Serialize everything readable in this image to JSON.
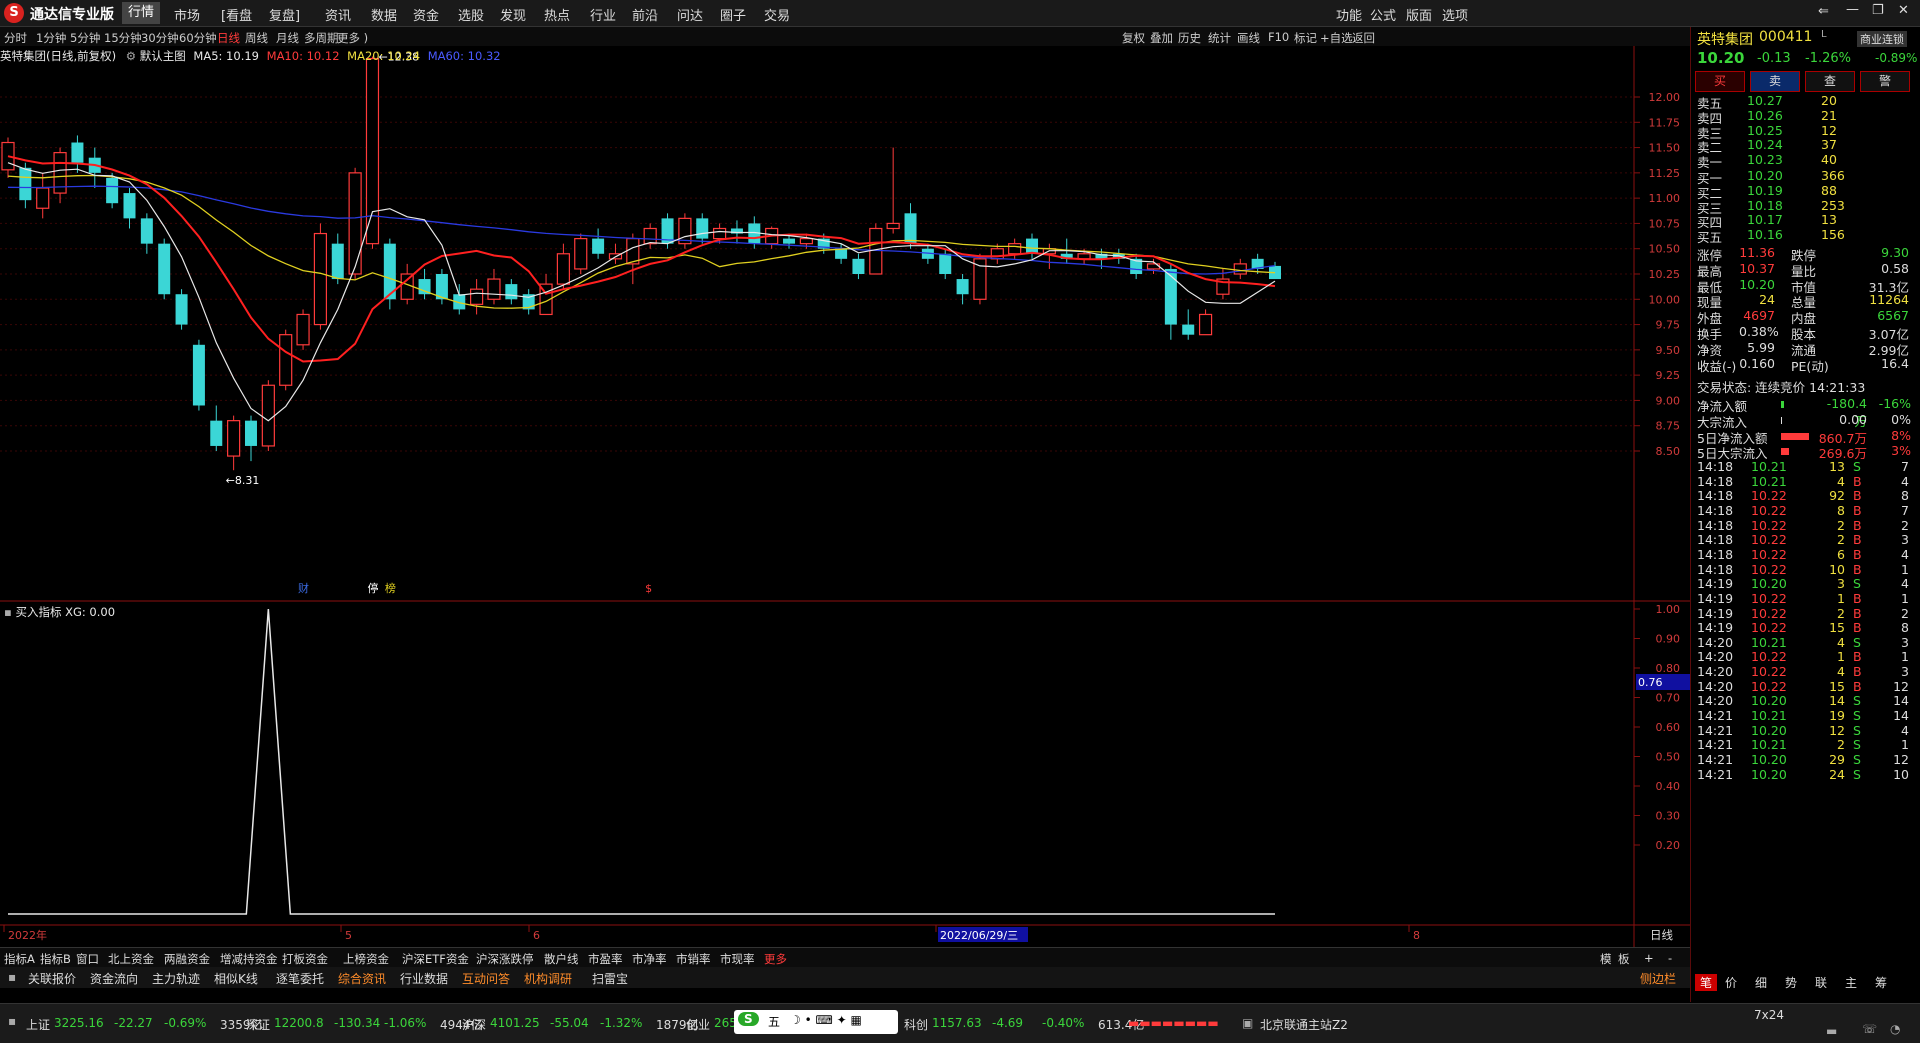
{
  "app": {
    "title": "通达信专业版"
  },
  "menu": [
    "行情",
    "市场",
    "[看盘",
    "复盘]",
    "资讯",
    "数据",
    "资金",
    "选股",
    "发现",
    "热点",
    "行业",
    "前沿",
    "问达",
    "圈子",
    "交易"
  ],
  "menu_right": [
    "功能",
    "公式",
    "版面",
    "选项"
  ],
  "periods": [
    "分时",
    "1分钟",
    "5分钟",
    "15分钟",
    "30分钟",
    "60分钟",
    "日线",
    "周线",
    "月线",
    "多周期",
    "更多 )"
  ],
  "active_period": "日线",
  "tools": [
    "复权",
    "叠加",
    "历史",
    "统计",
    "画线",
    "F10",
    "标记",
    "+自选",
    "返回"
  ],
  "chart_header": {
    "name": "英特集团(日线,前复权)",
    "template": "默认主图",
    "ma5": "MA5: 10.19",
    "ma10": "MA10: 10.12",
    "ma20": "MA20: 10.24",
    "ma60": "MA60: 10.32"
  },
  "main_axis": [
    "12.00",
    "11.75",
    "11.50",
    "11.25",
    "11.00",
    "10.75",
    "10.50",
    "10.25",
    "10.00",
    "9.75",
    "9.50",
    "9.25",
    "9.00",
    "8.75",
    "8.50"
  ],
  "high_mark": "12.38",
  "low_mark": "←8.31",
  "event_marks": [
    "财",
    "停",
    "榜",
    "$"
  ],
  "sub_header": "买入指标 XG: 0.00",
  "sub_axis": [
    "1.00",
    "0.90",
    "0.80",
    "0.70",
    "0.60",
    "0.50",
    "0.40",
    "0.30",
    "0.20"
  ],
  "sub_current": "0.76",
  "time_axis": {
    "year": "2022年",
    "m5": "5",
    "m6": "6",
    "date": "2022/06/29/三",
    "m8": "8"
  },
  "period_label": "日线",
  "indicator_tabs": [
    "指标A",
    "指标B",
    "窗口",
    "北上资金",
    "两融资金",
    "增减持资金",
    "打板资金",
    "上榜资金",
    "沪深ETF资金",
    "沪深涨跌停",
    "散户线",
    "市盈率",
    "市净率",
    "市销率",
    "市现率",
    "更多"
  ],
  "indicator_right": [
    "模",
    "板",
    "+",
    "-"
  ],
  "sub_tabs": [
    "关联报价",
    "资金流向",
    "主力轨迹",
    "相似K线",
    "逐笔委托",
    "综合资讯",
    "行业数据",
    "互动问答",
    "机构调研",
    "扫雷宝"
  ],
  "side_label": "侧边栏",
  "quote": {
    "name": "英特集团",
    "code": "000411",
    "price": "10.20",
    "change": "-0.13",
    "pct": "-1.26%",
    "sector": "商业连锁",
    "sector_pct": "-0.89%",
    "buttons": [
      "买",
      "卖",
      "查",
      "警"
    ]
  },
  "order_book": {
    "asks": [
      [
        "卖五",
        "10.27",
        "20"
      ],
      [
        "卖四",
        "10.26",
        "21"
      ],
      [
        "卖三",
        "10.25",
        "12"
      ],
      [
        "卖二",
        "10.24",
        "37"
      ],
      [
        "卖一",
        "10.23",
        "40"
      ]
    ],
    "bids": [
      [
        "买一",
        "10.20",
        "366"
      ],
      [
        "买二",
        "10.19",
        "88"
      ],
      [
        "买三",
        "10.18",
        "253"
      ],
      [
        "买四",
        "10.17",
        "13"
      ],
      [
        "买五",
        "10.16",
        "156"
      ]
    ]
  },
  "stats": [
    [
      "涨停",
      "11.36",
      "跌停",
      "9.30"
    ],
    [
      "最高",
      "10.37",
      "量比",
      "0.58"
    ],
    [
      "最低",
      "10.20",
      "市值",
      "31.3亿"
    ],
    [
      "现量",
      "24",
      "总量",
      "11264"
    ],
    [
      "外盘",
      "4697",
      "内盘",
      "6567"
    ],
    [
      "换手",
      "0.38%",
      "股本",
      "3.07亿"
    ],
    [
      "净资",
      "5.99",
      "流通",
      "2.99亿"
    ],
    [
      "收益(-)",
      "0.160",
      "PE(动)",
      "16.4"
    ]
  ],
  "trade_status": "交易状态: 连续竞价 14:21:33",
  "flows": [
    [
      "净流入额",
      "-180.4万",
      "-16%"
    ],
    [
      "大宗流入",
      "0.00",
      "0%"
    ],
    [
      "5日净流入额",
      "860.7万",
      "8%"
    ],
    [
      "5日大宗流入",
      "269.6万",
      "3%"
    ]
  ],
  "ticks": [
    [
      "14:18",
      "10.21",
      "13",
      "S",
      "7"
    ],
    [
      "14:18",
      "10.21",
      "4",
      "B",
      "4"
    ],
    [
      "14:18",
      "10.22",
      "92",
      "B",
      "8"
    ],
    [
      "14:18",
      "10.22",
      "8",
      "B",
      "7"
    ],
    [
      "14:18",
      "10.22",
      "2",
      "B",
      "2"
    ],
    [
      "14:18",
      "10.22",
      "2",
      "B",
      "3"
    ],
    [
      "14:18",
      "10.22",
      "6",
      "B",
      "4"
    ],
    [
      "14:18",
      "10.22",
      "10",
      "B",
      "1"
    ],
    [
      "14:19",
      "10.20",
      "3",
      "S",
      "4"
    ],
    [
      "14:19",
      "10.22",
      "1",
      "B",
      "1"
    ],
    [
      "14:19",
      "10.22",
      "2",
      "B",
      "2"
    ],
    [
      "14:19",
      "10.22",
      "15",
      "B",
      "8"
    ],
    [
      "14:20",
      "10.21",
      "4",
      "S",
      "3"
    ],
    [
      "14:20",
      "10.22",
      "1",
      "B",
      "1"
    ],
    [
      "14:20",
      "10.22",
      "4",
      "B",
      "3"
    ],
    [
      "14:20",
      "10.22",
      "15",
      "B",
      "12"
    ],
    [
      "14:20",
      "10.20",
      "14",
      "S",
      "14"
    ],
    [
      "14:21",
      "10.21",
      "19",
      "S",
      "14"
    ],
    [
      "14:21",
      "10.20",
      "12",
      "S",
      "4"
    ],
    [
      "14:21",
      "10.21",
      "2",
      "S",
      "1"
    ],
    [
      "14:21",
      "10.20",
      "29",
      "S",
      "12"
    ],
    [
      "14:21",
      "10.20",
      "24",
      "S",
      "10"
    ]
  ],
  "right_tabs": [
    "笔",
    "价",
    "细",
    "势",
    "联",
    "主",
    "筹"
  ],
  "status": {
    "sh": [
      "上证",
      "3225.16",
      "-22.27",
      "-0.69%",
      "3359亿"
    ],
    "sz": [
      "深证",
      "12200.8",
      "-130.34",
      "-1.06%",
      "4944亿"
    ],
    "hs": [
      "沪深",
      "4101.25",
      "-55.04",
      "-1.32%",
      "1879亿"
    ],
    "cy": [
      "创业",
      "2653..."
    ],
    "kc": [
      "科创",
      "1157.63",
      "-4.69",
      "-0.40%",
      "613.4亿"
    ],
    "ime": "五",
    "server": "北京联通主站Z2",
    "clock": "7x24"
  },
  "colors": {
    "up": "#ff3b3b",
    "down": "#3bd6d6",
    "ma5": "#e8e8e8",
    "ma10": "#ff2020",
    "ma20": "#e0d020",
    "ma60": "#2a3ae0"
  },
  "candles": [
    {
      "o": 11.28,
      "c": 11.55,
      "h": 11.6,
      "l": 11.2
    },
    {
      "o": 11.3,
      "c": 10.98,
      "h": 11.35,
      "l": 10.9
    },
    {
      "o": 10.9,
      "c": 11.1,
      "h": 11.25,
      "l": 10.8
    },
    {
      "o": 11.05,
      "c": 11.45,
      "h": 11.5,
      "l": 10.95
    },
    {
      "o": 11.55,
      "c": 11.35,
      "h": 11.62,
      "l": 11.25
    },
    {
      "o": 11.4,
      "c": 11.25,
      "h": 11.5,
      "l": 11.1
    },
    {
      "o": 11.2,
      "c": 10.95,
      "h": 11.25,
      "l": 10.9
    },
    {
      "o": 11.05,
      "c": 10.8,
      "h": 11.1,
      "l": 10.7
    },
    {
      "o": 10.8,
      "c": 10.55,
      "h": 10.85,
      "l": 10.45
    },
    {
      "o": 10.55,
      "c": 10.05,
      "h": 10.6,
      "l": 10.0
    },
    {
      "o": 10.05,
      "c": 9.75,
      "h": 10.1,
      "l": 9.7
    },
    {
      "o": 9.55,
      "c": 8.95,
      "h": 9.6,
      "l": 8.9
    },
    {
      "o": 8.8,
      "c": 8.55,
      "h": 8.95,
      "l": 8.5
    },
    {
      "o": 8.45,
      "c": 8.8,
      "h": 8.85,
      "l": 8.31
    },
    {
      "o": 8.8,
      "c": 8.55,
      "h": 8.85,
      "l": 8.4
    },
    {
      "o": 8.55,
      "c": 9.15,
      "h": 9.2,
      "l": 8.5
    },
    {
      "o": 9.15,
      "c": 9.65,
      "h": 9.7,
      "l": 9.1
    },
    {
      "o": 9.55,
      "c": 9.85,
      "h": 9.9,
      "l": 9.5
    },
    {
      "o": 9.75,
      "c": 10.65,
      "h": 10.75,
      "l": 9.7
    },
    {
      "o": 10.55,
      "c": 10.2,
      "h": 10.65,
      "l": 10.15
    },
    {
      "o": 10.25,
      "c": 11.25,
      "h": 11.3,
      "l": 10.2
    },
    {
      "o": 10.55,
      "c": 12.38,
      "h": 12.4,
      "l": 10.5
    },
    {
      "o": 10.55,
      "c": 10.0,
      "h": 10.6,
      "l": 9.9
    },
    {
      "o": 10.0,
      "c": 10.25,
      "h": 10.35,
      "l": 9.95
    },
    {
      "o": 10.2,
      "c": 10.05,
      "h": 10.3,
      "l": 10.0
    },
    {
      "o": 10.25,
      "c": 10.0,
      "h": 10.3,
      "l": 9.95
    },
    {
      "o": 10.05,
      "c": 9.9,
      "h": 10.15,
      "l": 9.85
    },
    {
      "o": 9.95,
      "c": 10.1,
      "h": 10.2,
      "l": 9.85
    },
    {
      "o": 10.0,
      "c": 10.2,
      "h": 10.3,
      "l": 9.95
    },
    {
      "o": 10.15,
      "c": 10.0,
      "h": 10.2,
      "l": 9.95
    },
    {
      "o": 10.05,
      "c": 9.9,
      "h": 10.1,
      "l": 9.85
    },
    {
      "o": 9.85,
      "c": 10.15,
      "h": 10.25,
      "l": 9.85
    },
    {
      "o": 10.15,
      "c": 10.45,
      "h": 10.55,
      "l": 10.1
    },
    {
      "o": 10.3,
      "c": 10.6,
      "h": 10.65,
      "l": 10.25
    },
    {
      "o": 10.6,
      "c": 10.45,
      "h": 10.7,
      "l": 10.4
    },
    {
      "o": 10.4,
      "c": 10.45,
      "h": 10.55,
      "l": 10.35
    },
    {
      "o": 10.35,
      "c": 10.6,
      "h": 10.65,
      "l": 10.15
    },
    {
      "o": 10.55,
      "c": 10.7,
      "h": 10.75,
      "l": 10.5
    },
    {
      "o": 10.8,
      "c": 10.55,
      "h": 10.85,
      "l": 10.5
    },
    {
      "o": 10.55,
      "c": 10.8,
      "h": 10.85,
      "l": 10.5
    },
    {
      "o": 10.8,
      "c": 10.6,
      "h": 10.85,
      "l": 10.55
    },
    {
      "o": 10.6,
      "c": 10.7,
      "h": 10.75,
      "l": 10.55
    },
    {
      "o": 10.7,
      "c": 10.65,
      "h": 10.78,
      "l": 10.55
    },
    {
      "o": 10.75,
      "c": 10.55,
      "h": 10.82,
      "l": 10.5
    },
    {
      "o": 10.55,
      "c": 10.7,
      "h": 10.72,
      "l": 10.5
    },
    {
      "o": 10.6,
      "c": 10.55,
      "h": 10.65,
      "l": 10.5
    },
    {
      "o": 10.55,
      "c": 10.6,
      "h": 10.65,
      "l": 10.5
    },
    {
      "o": 10.6,
      "c": 10.5,
      "h": 10.65,
      "l": 10.45
    },
    {
      "o": 10.5,
      "c": 10.4,
      "h": 10.55,
      "l": 10.35
    },
    {
      "o": 10.4,
      "c": 10.25,
      "h": 10.45,
      "l": 10.2
    },
    {
      "o": 10.25,
      "c": 10.7,
      "h": 10.75,
      "l": 10.25
    },
    {
      "o": 10.7,
      "c": 10.75,
      "h": 11.5,
      "l": 10.65
    },
    {
      "o": 10.85,
      "c": 10.55,
      "h": 10.95,
      "l": 10.5
    },
    {
      "o": 10.5,
      "c": 10.4,
      "h": 10.55,
      "l": 10.35
    },
    {
      "o": 10.45,
      "c": 10.25,
      "h": 10.5,
      "l": 10.2
    },
    {
      "o": 10.2,
      "c": 10.05,
      "h": 10.25,
      "l": 9.95
    },
    {
      "o": 10.0,
      "c": 10.4,
      "h": 10.45,
      "l": 9.95
    },
    {
      "o": 10.4,
      "c": 10.5,
      "h": 10.55,
      "l": 10.35
    },
    {
      "o": 10.45,
      "c": 10.55,
      "h": 10.6,
      "l": 10.4
    },
    {
      "o": 10.6,
      "c": 10.45,
      "h": 10.65,
      "l": 10.4
    },
    {
      "o": 10.45,
      "c": 10.5,
      "h": 10.55,
      "l": 10.3
    },
    {
      "o": 10.45,
      "c": 10.4,
      "h": 10.6,
      "l": 10.35
    },
    {
      "o": 10.4,
      "c": 10.45,
      "h": 10.5,
      "l": 10.35
    },
    {
      "o": 10.45,
      "c": 10.4,
      "h": 10.5,
      "l": 10.3
    },
    {
      "o": 10.45,
      "c": 10.4,
      "h": 10.5,
      "l": 10.35
    },
    {
      "o": 10.4,
      "c": 10.25,
      "h": 10.45,
      "l": 10.2
    },
    {
      "o": 10.3,
      "c": 10.35,
      "h": 10.4,
      "l": 10.25
    },
    {
      "o": 10.3,
      "c": 9.75,
      "h": 10.35,
      "l": 9.6
    },
    {
      "o": 9.75,
      "c": 9.65,
      "h": 9.9,
      "l": 9.6
    },
    {
      "o": 9.65,
      "c": 9.85,
      "h": 9.9,
      "l": 9.65
    },
    {
      "o": 10.05,
      "c": 10.2,
      "h": 10.3,
      "l": 10.0
    },
    {
      "o": 10.25,
      "c": 10.35,
      "h": 10.4,
      "l": 10.2
    },
    {
      "o": 10.4,
      "c": 10.3,
      "h": 10.45,
      "l": 10.25
    },
    {
      "o": 10.33,
      "c": 10.2,
      "h": 10.37,
      "l": 10.2
    }
  ],
  "xg_peak_index": 15
}
